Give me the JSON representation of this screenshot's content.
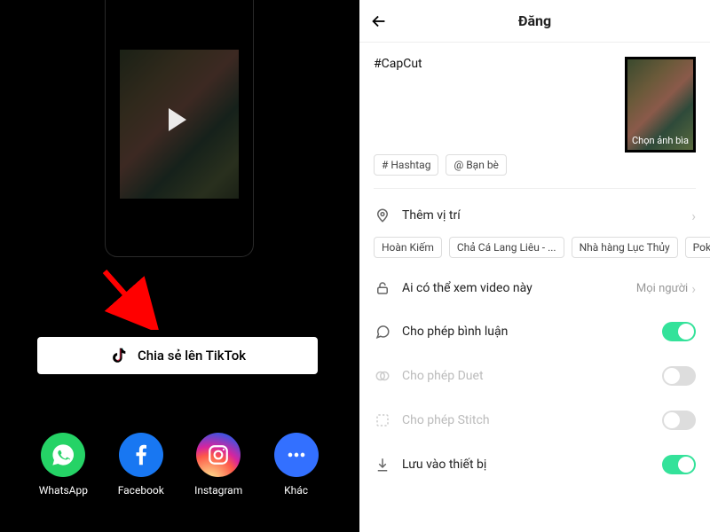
{
  "left": {
    "share_button_label": "Chia sẻ lên TikTok",
    "share_targets": [
      {
        "id": "whatsapp",
        "label": "WhatsApp"
      },
      {
        "id": "facebook",
        "label": "Facebook"
      },
      {
        "id": "instagram",
        "label": "Instagram"
      },
      {
        "id": "more",
        "label": "Khác"
      }
    ]
  },
  "right": {
    "title": "Đăng",
    "caption": "#CapCut",
    "cover_label": "Chọn ảnh bìa",
    "chips": {
      "hashtag": "# Hashtag",
      "friends": "@ Bạn bè"
    },
    "rows": {
      "location": {
        "label": "Thêm vị trí"
      },
      "privacy": {
        "label": "Ai có thể xem video này",
        "value": "Mọi người"
      },
      "comments": {
        "label": "Cho phép bình luận",
        "on": true
      },
      "duet": {
        "label": "Cho phép Duet",
        "on": false
      },
      "stitch": {
        "label": "Cho phép Stitch",
        "on": false
      },
      "save": {
        "label": "Lưu vào thiết bị",
        "on": true
      }
    },
    "location_suggestions": [
      "Hoàn Kiếm",
      "Chả Cá Lang Liêu - ...",
      "Nhà hàng Lục Thủy",
      "Poke Hanoi"
    ]
  }
}
